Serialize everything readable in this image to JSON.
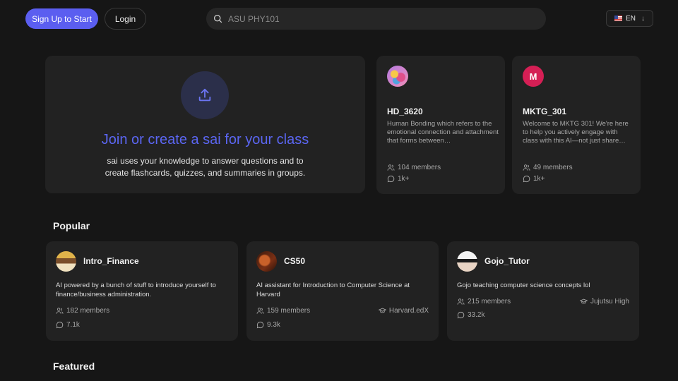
{
  "header": {
    "signup_label": "Sign Up to Start",
    "login_label": "Login",
    "search_placeholder": "ASU PHY101",
    "lang_label": "EN"
  },
  "hero": {
    "title": "Join or create a sai for your class",
    "subtitle_line1": "sai uses your knowledge to answer questions and to",
    "subtitle_line2": "create flashcards, quizzes, and summaries in groups."
  },
  "top_cards": [
    {
      "name": "HD_3620",
      "description": "Human Bonding which refers to the emotional connection and attachment that forms between…",
      "members": "104 members",
      "messages": "1k+"
    },
    {
      "name": "MKTG_301",
      "avatar_letter": "M",
      "description": "Welcome to MKTG 301! We're here to help you actively engage with class with this AI—not just share…",
      "members": "49 members",
      "messages": "1k+"
    }
  ],
  "sections": {
    "popular": "Popular",
    "featured": "Featured"
  },
  "popular": [
    {
      "name": "Intro_Finance",
      "description": "AI powered by a bunch of stuff to introduce yourself to finance/business administration.",
      "members": "182 members",
      "messages": "7.1k"
    },
    {
      "name": "CS50",
      "description": "AI assistant for Introduction to Computer Science at Harvard",
      "members": "159 members",
      "messages": "9.3k",
      "org": "Harvard.edX"
    },
    {
      "name": "Gojo_Tutor",
      "description": "Gojo teaching computer science concepts lol",
      "members": "215 members",
      "messages": "33.2k",
      "org": "Jujutsu High"
    }
  ],
  "colors": {
    "accent": "#5b5ef0",
    "hero_title": "#5b66f2",
    "background": "#161616",
    "card": "#222222"
  },
  "icons": {
    "search": "search-icon",
    "upload": "upload-icon",
    "members": "users-icon",
    "messages": "chat-bubble-icon",
    "org": "graduation-cap-icon",
    "lang_arrow": "arrow-down-icon",
    "flag": "us-flag-icon"
  }
}
